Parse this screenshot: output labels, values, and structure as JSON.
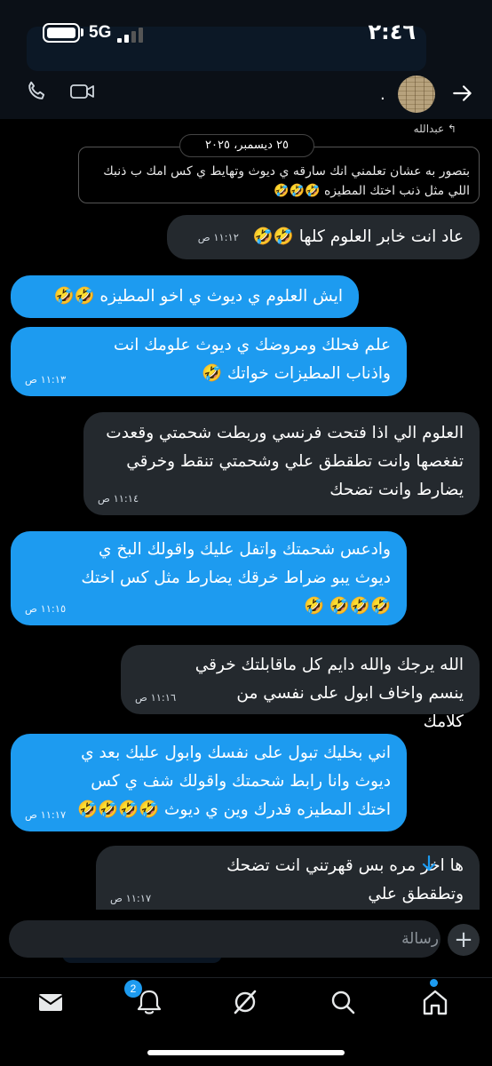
{
  "status_bar": {
    "time": "٢:٤٦",
    "network": "5G"
  },
  "header": {
    "contact_name": "."
  },
  "chat": {
    "reply_reference": "↰ عبدالله",
    "date_separator": "٢٥ ديسمبر، ٢٠٢٥",
    "quoted_message": "بتصور به عشان تعلمني انك سارقه ي ديوث وتهايط ي كس امك ب ذنبك اللي مثل ذنب اختك المطيزه 🤣🤣🤣",
    "messages": [
      {
        "dir": "received",
        "text": "عاد انت خابر العلوم كلها 🤣🤣",
        "time": "١١:١٢ ص"
      },
      {
        "dir": "sent",
        "text": "ايش العلوم ي ديوث ي اخو المطيزه 🤣🤣",
        "time": ""
      },
      {
        "dir": "sent",
        "text": "علم فحلك ومروضك ي ديوث علومك انت واذناب المطيزات خواتك 🤣",
        "time": "١١:١٣ ص"
      },
      {
        "dir": "received",
        "text": "العلوم الي اذا فتحت فرنسي وربطت شحمتي وقعدت تفغصها وانت تطقطق علي وشحمتي تنقط وخرقي يضارط وانت تضحك",
        "time": "١١:١٤ ص"
      },
      {
        "dir": "sent",
        "text": "وادعس شحمتك واتفل عليك واقولك البخ ي ديوث يبو ضراط خرقك يضارط مثل كس اختك 🤣🤣🤣 🤣",
        "time": "١١:١٥ ص"
      },
      {
        "dir": "received",
        "text": "الله يرجك والله دايم كل ماقابلتك خرقي ينسم واخاف ابول على نفسي من كلامك",
        "time": "١١:١٦ ص"
      },
      {
        "dir": "sent",
        "text": "اني بخليك تبول على نفسك وابول عليك بعد ي ديوث وانا رابط شحمتك واقولك شف ي كس اختك المطيزه قدرك وين ي ديوث 🤣🤣🤣🤣",
        "time": "١١:١٧ ص"
      },
      {
        "dir": "received",
        "text": "ها اخر مره بس قهرتني انت تضحك وتطقطق علي",
        "time": "١١:١٧ ص"
      }
    ]
  },
  "composer": {
    "placeholder": "رسالة"
  },
  "tabbar": {
    "notifications_badge": "2"
  },
  "colors": {
    "sent_bubble": "#1d9bf0",
    "received_bubble": "#24292e",
    "background": "#000000"
  }
}
